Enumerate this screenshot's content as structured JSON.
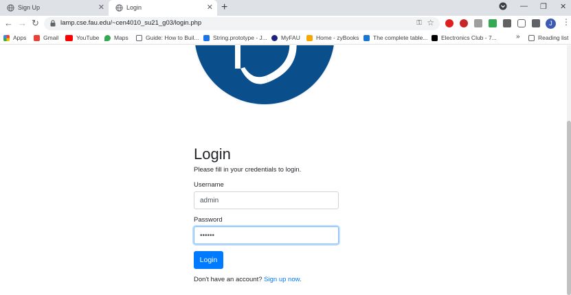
{
  "browser": {
    "tabs": [
      {
        "title": "Sign Up",
        "active": false
      },
      {
        "title": "Login",
        "active": true
      }
    ],
    "url": "lamp.cse.fau.edu/~cen4010_su21_g03/login.php",
    "profile_initial": "J",
    "extension_badge": "1"
  },
  "bookmarks": [
    {
      "label": "Apps",
      "icon": "apps-grid-icon",
      "color": "#ea4335"
    },
    {
      "label": "Gmail",
      "icon": "gmail-icon",
      "color": "#ea4335"
    },
    {
      "label": "YouTube",
      "icon": "youtube-icon",
      "color": "#ff0000"
    },
    {
      "label": "Maps",
      "icon": "maps-pin-icon",
      "color": "#34a853"
    },
    {
      "label": "Guide: How to Buil...",
      "icon": "page-icon",
      "color": "#5f6368"
    },
    {
      "label": "String.prototype - J...",
      "icon": "mdn-icon",
      "color": "#1a73e8"
    },
    {
      "label": "MyFAU",
      "icon": "fau-icon",
      "color": "#1a237e"
    },
    {
      "label": "Home - zyBooks",
      "icon": "zybooks-icon",
      "color": "#f6a800"
    },
    {
      "label": "The complete table...",
      "icon": "bookmark-icon",
      "color": "#1976d2"
    },
    {
      "label": "Electronics Club - 7...",
      "icon": "ec-icon",
      "color": "#000000"
    }
  ],
  "bookmarks_overflow": "»",
  "reading_list": "Reading list",
  "page": {
    "heading": "Login",
    "subtitle": "Please fill in your credentials to login.",
    "username_label": "Username",
    "username_value": "admin",
    "password_label": "Password",
    "password_value": "••••••",
    "login_button": "Login",
    "footer_prefix": "Don't have an account?",
    "footer_link": "Sign up now",
    "footer_suffix": "."
  },
  "colors": {
    "primary": "#007bff",
    "logo_blue": "#0a4f8c"
  }
}
